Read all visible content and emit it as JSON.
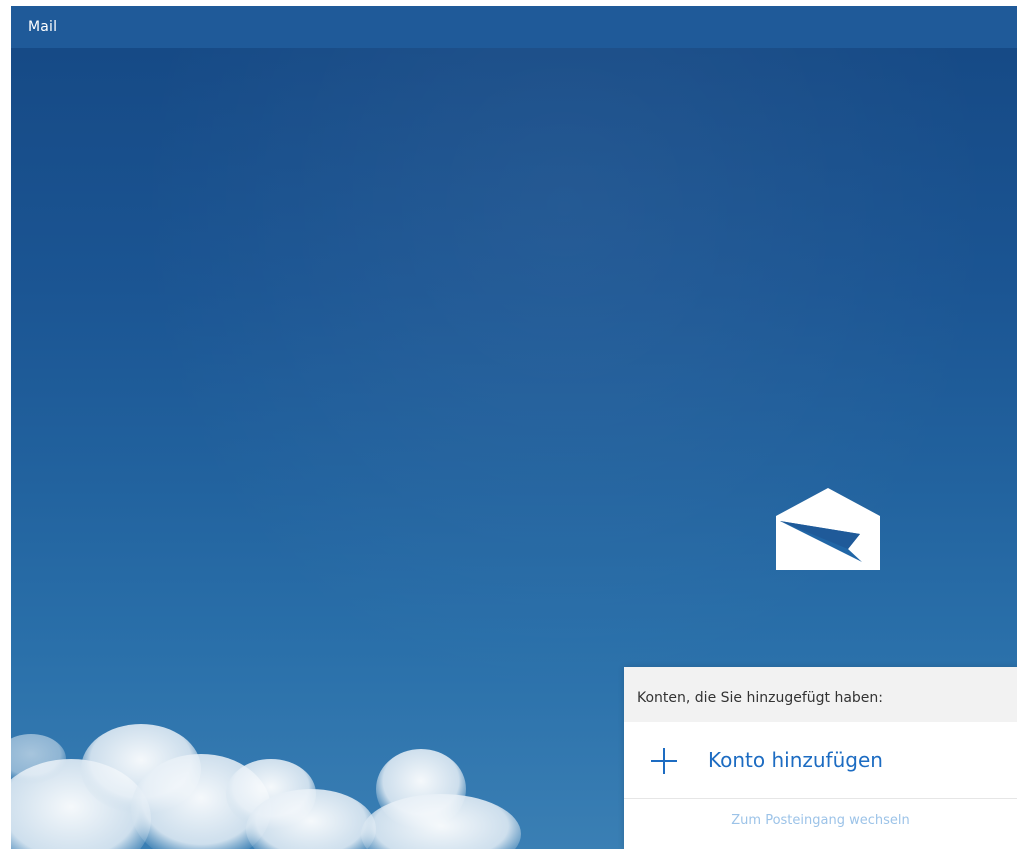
{
  "titlebar": {
    "title": "Mail"
  },
  "panel": {
    "header_label": "Konten, die Sie hinzugefügt haben:",
    "add_account_label": "Konto hinzufügen",
    "switch_inbox_label": "Zum Posteingang wechseln"
  },
  "icons": {
    "app_logo": "mail-envelope-icon",
    "add": "plus-icon"
  },
  "colors": {
    "titlebar": "#1f5a99",
    "accent": "#1d6cc2",
    "disabled_link": "#9cc3e8",
    "panel_header": "#f2f2f2"
  }
}
